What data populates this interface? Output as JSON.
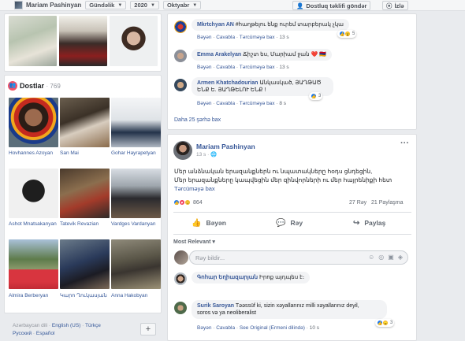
{
  "topbar": {
    "name": "Mariam Pashinyan",
    "filter": "Gündəlik",
    "year": "2020",
    "month": "Oktyabr",
    "friend_btn": "Dostluq təklifi göndər",
    "follow_btn": "İzlə",
    "friend_icon": "add-friend-icon",
    "follow_icon": "rss-icon"
  },
  "friends": {
    "title": "Dostlar",
    "count": "· 769",
    "icon": "friends-icon",
    "items": [
      {
        "name": "Hovhannes Azoyan"
      },
      {
        "name": "San Mai"
      },
      {
        "name": "Gohar Hayrapetyan"
      },
      {
        "name": "Ashot Mnatsakanyan"
      },
      {
        "name": "Tatevik Revazian"
      },
      {
        "name": "Vardges Vardanyan"
      },
      {
        "name": "Almira Berberyan"
      },
      {
        "name": "Կարո Ղուկասյան"
      },
      {
        "name": "Anna Hakobyan"
      }
    ]
  },
  "footer": {
    "langs_line1": [
      "Azərbaycan dili",
      "English (US)",
      "Türkçe"
    ],
    "langs_line2": [
      "Русский",
      "Español"
    ],
    "plus": "+"
  },
  "comments_top": [
    {
      "author": "Mkrtchyan AN",
      "text": "#հաղթելու ենք ուրեմ տարբերակ չկա",
      "actions": [
        "Bəyən",
        "Cavabla",
        "Tərcüməyə bax"
      ],
      "time": "13 s",
      "react_count": "5"
    },
    {
      "author": "Emma Arakelyan",
      "text": "Ճիշտ ես, Մարիամ ջան ❤️ 🇦🇲",
      "actions": [
        "Bəyən",
        "Cavabla",
        "Tərcüməyə bax"
      ],
      "time": "13 s"
    },
    {
      "author": "Armen Khatchadourian",
      "text": "Անկասկած, ՅԱՂԹԱԾ ԵՆՔ Ե. ՅԱՂԹԵԼՈՒ ԵՆՔ !",
      "actions": [
        "Bəyən",
        "Cavabla",
        "Tərcüməyə bax"
      ],
      "time": "8 s",
      "react_count": "3"
    }
  ],
  "more_comments": "Daha 25 şərhə bax",
  "post": {
    "author": "Mariam Pashinyan",
    "time": "13 s",
    "globe_icon": "globe-icon",
    "more_icon": "more-options-icon",
    "text_line1": "Մեր անձնական երազանքներն ու նպատակները հօդս ցնդեցին,",
    "text_line2": "Մեր երազանքները կապվեցին մեր զինվորների ու մեր հայրենիքի հետ",
    "translate": "Tərcüməyə bax",
    "reaction_count": "864",
    "stats": "27 Rəy   21 Paylaşma",
    "actions": {
      "like": "Bəyən",
      "comment": "Rəy",
      "share": "Paylaş"
    },
    "sort": "Most Relevant",
    "input_placeholder": "Rəy bildir..."
  },
  "comments_bottom": [
    {
      "author": "Գոհար Եղիազարյան",
      "text": "Իրոք այդպես է։"
    },
    {
      "author": "Surik Saroyan",
      "text_line1": "Təəssüf ki, sizin xəyallarınız milli xəyallarınız deyil,",
      "text_line2": "soros və ya neoliberalist",
      "actions": [
        "Bəyən",
        "Cavabla",
        "See Original (Ermeni dilində)"
      ],
      "time": "10 s",
      "react_count": "3"
    }
  ]
}
